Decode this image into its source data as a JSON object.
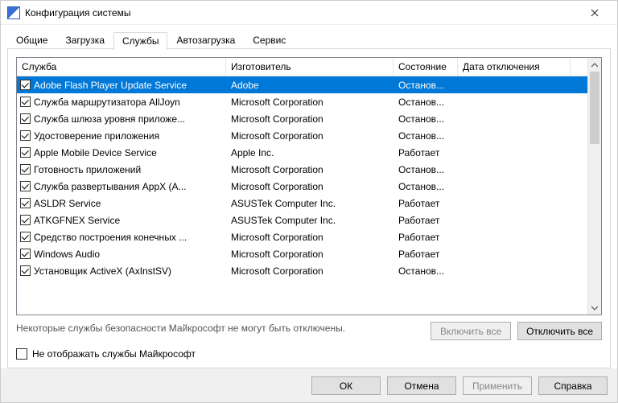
{
  "window": {
    "title": "Конфигурация системы"
  },
  "tabs": {
    "items": [
      {
        "label": "Общие"
      },
      {
        "label": "Загрузка"
      },
      {
        "label": "Службы"
      },
      {
        "label": "Автозагрузка"
      },
      {
        "label": "Сервис"
      }
    ],
    "active_index": 2
  },
  "columns": {
    "service": "Служба",
    "manufacturer": "Изготовитель",
    "state": "Состояние",
    "date": "Дата отключения"
  },
  "services": [
    {
      "checked": true,
      "selected": true,
      "name": "Adobe Flash Player Update Service",
      "mfr": "Adobe",
      "state": "Останов...",
      "date": ""
    },
    {
      "checked": true,
      "selected": false,
      "name": "Служба маршрутизатора AllJoyn",
      "mfr": "Microsoft Corporation",
      "state": "Останов...",
      "date": ""
    },
    {
      "checked": true,
      "selected": false,
      "name": "Служба шлюза уровня приложе...",
      "mfr": "Microsoft Corporation",
      "state": "Останов...",
      "date": ""
    },
    {
      "checked": true,
      "selected": false,
      "name": "Удостоверение приложения",
      "mfr": "Microsoft Corporation",
      "state": "Останов...",
      "date": ""
    },
    {
      "checked": true,
      "selected": false,
      "name": "Apple Mobile Device Service",
      "mfr": "Apple Inc.",
      "state": "Работает",
      "date": ""
    },
    {
      "checked": true,
      "selected": false,
      "name": "Готовность приложений",
      "mfr": "Microsoft Corporation",
      "state": "Останов...",
      "date": ""
    },
    {
      "checked": true,
      "selected": false,
      "name": "Служба развертывания AppX (A...",
      "mfr": "Microsoft Corporation",
      "state": "Останов...",
      "date": ""
    },
    {
      "checked": true,
      "selected": false,
      "name": "ASLDR Service",
      "mfr": "ASUSTek Computer Inc.",
      "state": "Работает",
      "date": ""
    },
    {
      "checked": true,
      "selected": false,
      "name": "ATKGFNEX Service",
      "mfr": "ASUSTek Computer Inc.",
      "state": "Работает",
      "date": ""
    },
    {
      "checked": true,
      "selected": false,
      "name": "Средство построения конечных ...",
      "mfr": "Microsoft Corporation",
      "state": "Работает",
      "date": ""
    },
    {
      "checked": true,
      "selected": false,
      "name": "Windows Audio",
      "mfr": "Microsoft Corporation",
      "state": "Работает",
      "date": ""
    },
    {
      "checked": true,
      "selected": false,
      "name": "Установщик ActiveX (AxInstSV)",
      "mfr": "Microsoft Corporation",
      "state": "Останов...",
      "date": ""
    }
  ],
  "note": "Некоторые службы безопасности Майкрософт не могут быть отключены.",
  "buttons": {
    "enable_all": "Включить все",
    "disable_all": "Отключить все"
  },
  "hide_ms": {
    "label": "Не отображать службы Майкрософт",
    "checked": false
  },
  "footer": {
    "ok": "ОК",
    "cancel": "Отмена",
    "apply": "Применить",
    "help": "Справка"
  }
}
